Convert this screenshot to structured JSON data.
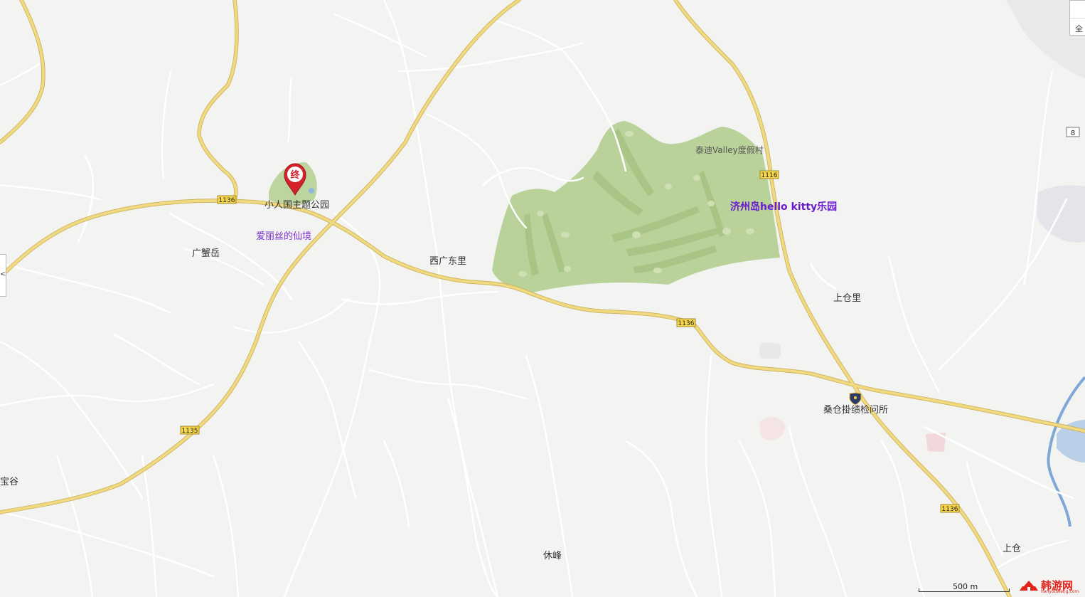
{
  "map": {
    "places": {
      "park_label": "小人国主题公园",
      "alice_label": "爱丽丝的仙境",
      "guangxie_label": "广蟹岳",
      "xiguang_label": "西广东里",
      "teddy_label": "泰迪Valley度假村",
      "hellokitty_label": "济州岛hello kitty乐园",
      "shangcangli_label": "上仓里",
      "checkpoint_label": "桑仓掛绩检问所",
      "xiufeng_label": "休峰",
      "baogu_label": "宝谷",
      "shangcang_label": "上仓"
    },
    "marker": {
      "glyph": "终"
    },
    "road_shields": [
      "1136",
      "1136",
      "1136",
      "1135",
      "1116",
      "1136",
      "8"
    ]
  },
  "controls": {
    "zoom_label": "全",
    "left_tab_label": "<"
  },
  "scale_bar": {
    "label": "500 m"
  },
  "brand": {
    "name": "韩游网",
    "sub": "hanyouwang.com"
  },
  "colors": {
    "background": "#f3f3f1",
    "road_major": "#f0d980",
    "road_minor": "#ffffff",
    "golf_green": "#b9d29a",
    "marker_red": "#d4212a",
    "label_purple": "#7a2fd0"
  }
}
